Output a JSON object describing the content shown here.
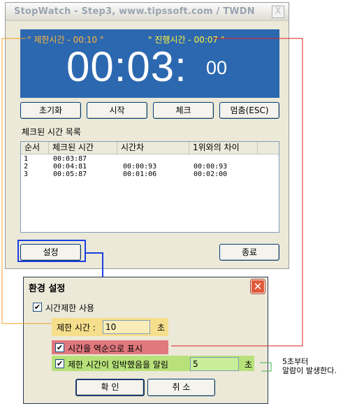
{
  "window": {
    "title": "StopWatch - Step3, www.tipssoft.com / TWDN",
    "close_label": "X"
  },
  "display": {
    "limit_text": "\" 제한시간 - 00:10 \"",
    "progress_text": "\" 진행시간 - 00:07 \"",
    "time_main": "00:03:",
    "time_ms": "00",
    "bg_color": "#2c68b0",
    "limit_color": "#ffb638",
    "progress_color": "#fff23a"
  },
  "buttons": {
    "reset": "초기화",
    "start": "시작",
    "check": "체크",
    "stop": "멈춤(ESC)",
    "settings": "설정",
    "exit": "종료"
  },
  "check_list": {
    "title": "체크된 시간 목록",
    "columns": [
      "순서",
      "체크된 시간",
      "시간차",
      "1위와의 차이"
    ],
    "rows": [
      [
        "1",
        "00:03:87",
        "",
        ""
      ],
      [
        "2",
        "00:04:81",
        "00:00:93",
        "00:00:93"
      ],
      [
        "3",
        "00:05:87",
        "00:01:06",
        "00:02:00"
      ]
    ]
  },
  "settings_dialog": {
    "title": "환경 설정",
    "use_limit_label": "시간제한 사용",
    "use_limit_checked": "✔",
    "limit_time_label": "제한 시간 :",
    "limit_time_value": "10",
    "limit_unit": "초",
    "reverse_label": "시간을 역순으로 표시",
    "reverse_checked": "✔",
    "alarm_label": "제한 시간이 임박했음을 알림",
    "alarm_checked": "✔",
    "alarm_value": "5",
    "alarm_unit": "초",
    "ok": "확 인",
    "cancel": "취 소",
    "close_label": "✕"
  },
  "annotation": {
    "line1": "5초부터",
    "line2": "알람이 발생한다."
  },
  "colors": {
    "orange": "#f0a020",
    "red": "#dd2222",
    "blue": "#1a3ee0",
    "green": "#3cb44b"
  }
}
